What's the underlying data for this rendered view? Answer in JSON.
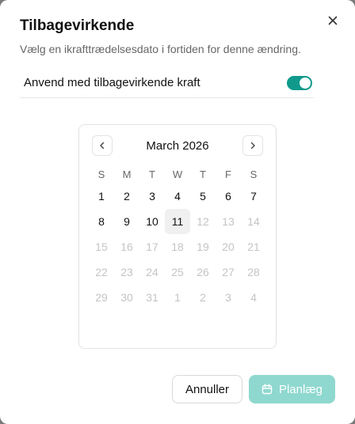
{
  "dialog": {
    "title": "Tilbagevirkende",
    "description": "Vælg en ikrafttrædelsesdato i fortiden for denne ændring.",
    "close_icon": "close-icon"
  },
  "toggle": {
    "label": "Anvend med tilbagevirkende kraft",
    "on": true,
    "color": "#0f9a8c"
  },
  "calendar": {
    "month_label": "March 2026",
    "prev_icon": "chevron-left-icon",
    "next_icon": "chevron-right-icon",
    "weekdays": [
      "S",
      "M",
      "T",
      "W",
      "T",
      "F",
      "S"
    ],
    "days": [
      {
        "label": "1",
        "disabled": false
      },
      {
        "label": "2",
        "disabled": false
      },
      {
        "label": "3",
        "disabled": false
      },
      {
        "label": "4",
        "disabled": false
      },
      {
        "label": "5",
        "disabled": false
      },
      {
        "label": "6",
        "disabled": false
      },
      {
        "label": "7",
        "disabled": false
      },
      {
        "label": "8",
        "disabled": false
      },
      {
        "label": "9",
        "disabled": false
      },
      {
        "label": "10",
        "disabled": false
      },
      {
        "label": "11",
        "disabled": false,
        "today": true
      },
      {
        "label": "12",
        "disabled": true
      },
      {
        "label": "13",
        "disabled": true
      },
      {
        "label": "14",
        "disabled": true
      },
      {
        "label": "15",
        "disabled": true
      },
      {
        "label": "16",
        "disabled": true
      },
      {
        "label": "17",
        "disabled": true
      },
      {
        "label": "18",
        "disabled": true
      },
      {
        "label": "19",
        "disabled": true
      },
      {
        "label": "20",
        "disabled": true
      },
      {
        "label": "21",
        "disabled": true
      },
      {
        "label": "22",
        "disabled": true
      },
      {
        "label": "23",
        "disabled": true
      },
      {
        "label": "24",
        "disabled": true
      },
      {
        "label": "25",
        "disabled": true
      },
      {
        "label": "26",
        "disabled": true
      },
      {
        "label": "27",
        "disabled": true
      },
      {
        "label": "28",
        "disabled": true
      },
      {
        "label": "29",
        "disabled": true
      },
      {
        "label": "30",
        "disabled": true
      },
      {
        "label": "31",
        "disabled": true
      },
      {
        "label": "1",
        "disabled": true
      },
      {
        "label": "2",
        "disabled": true
      },
      {
        "label": "3",
        "disabled": true
      },
      {
        "label": "4",
        "disabled": true
      }
    ]
  },
  "footer": {
    "cancel_label": "Annuller",
    "schedule_label": "Planlæg",
    "schedule_icon": "calendar-icon",
    "schedule_color": "#8fd8cf"
  }
}
